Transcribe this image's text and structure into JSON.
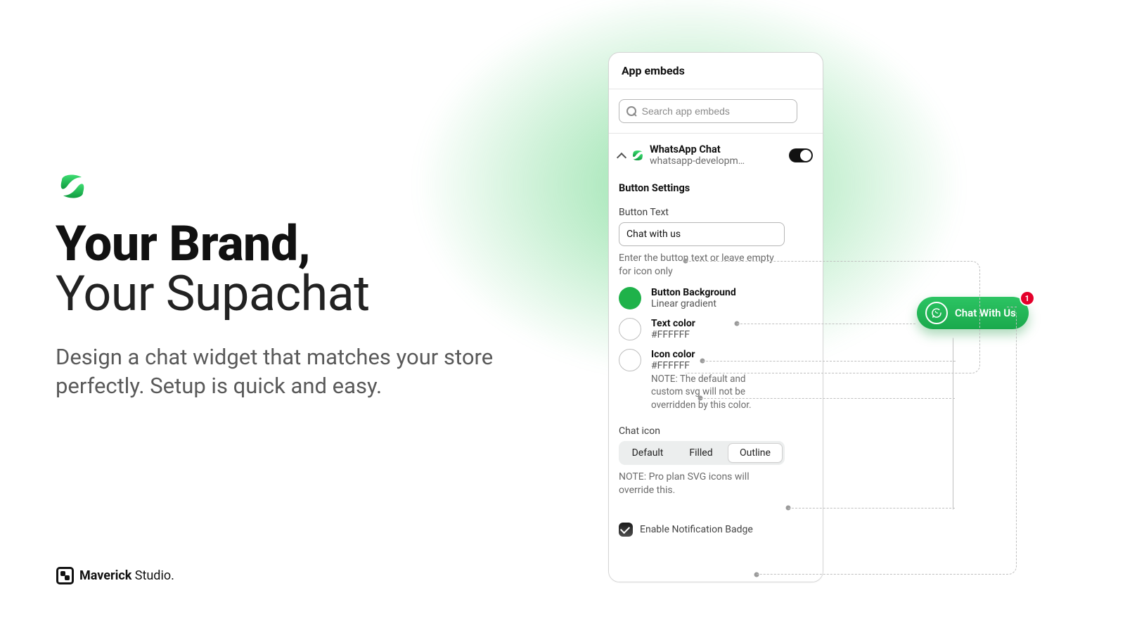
{
  "hero": {
    "title_bold": "Your Brand,",
    "title_light": "Your Supachat",
    "subtitle": "Design a chat widget that matches your store perfectly. Setup is quick and easy."
  },
  "footer": {
    "brand_bold": "Maverick",
    "brand_light": " Studio."
  },
  "panel": {
    "header": "App embeds",
    "search_placeholder": "Search app embeds",
    "embed": {
      "name": "WhatsApp Chat",
      "slug": "whatsapp-developm…"
    },
    "sections": {
      "button_settings": "Button Settings",
      "button_text_label": "Button Text",
      "button_text_value": "Chat with us",
      "button_text_help": "Enter the button text or leave empty for icon only",
      "bg": {
        "name": "Button Background",
        "value": "Linear gradient"
      },
      "textcolor": {
        "name": "Text color",
        "value": "#FFFFFF"
      },
      "iconcolor": {
        "name": "Icon color",
        "value": "#FFFFFF",
        "note": "NOTE: The default and custom svg will not be overridden by this color."
      },
      "chat_icon_label": "Chat icon",
      "icon_opts": {
        "default": "Default",
        "filled": "Filled",
        "outline": "Outline"
      },
      "icon_note": "NOTE: Pro plan SVG icons will override this.",
      "badge_checkbox": "Enable Notification Badge"
    }
  },
  "chat_pill": {
    "label": "Chat With Us",
    "badge_count": "1"
  }
}
